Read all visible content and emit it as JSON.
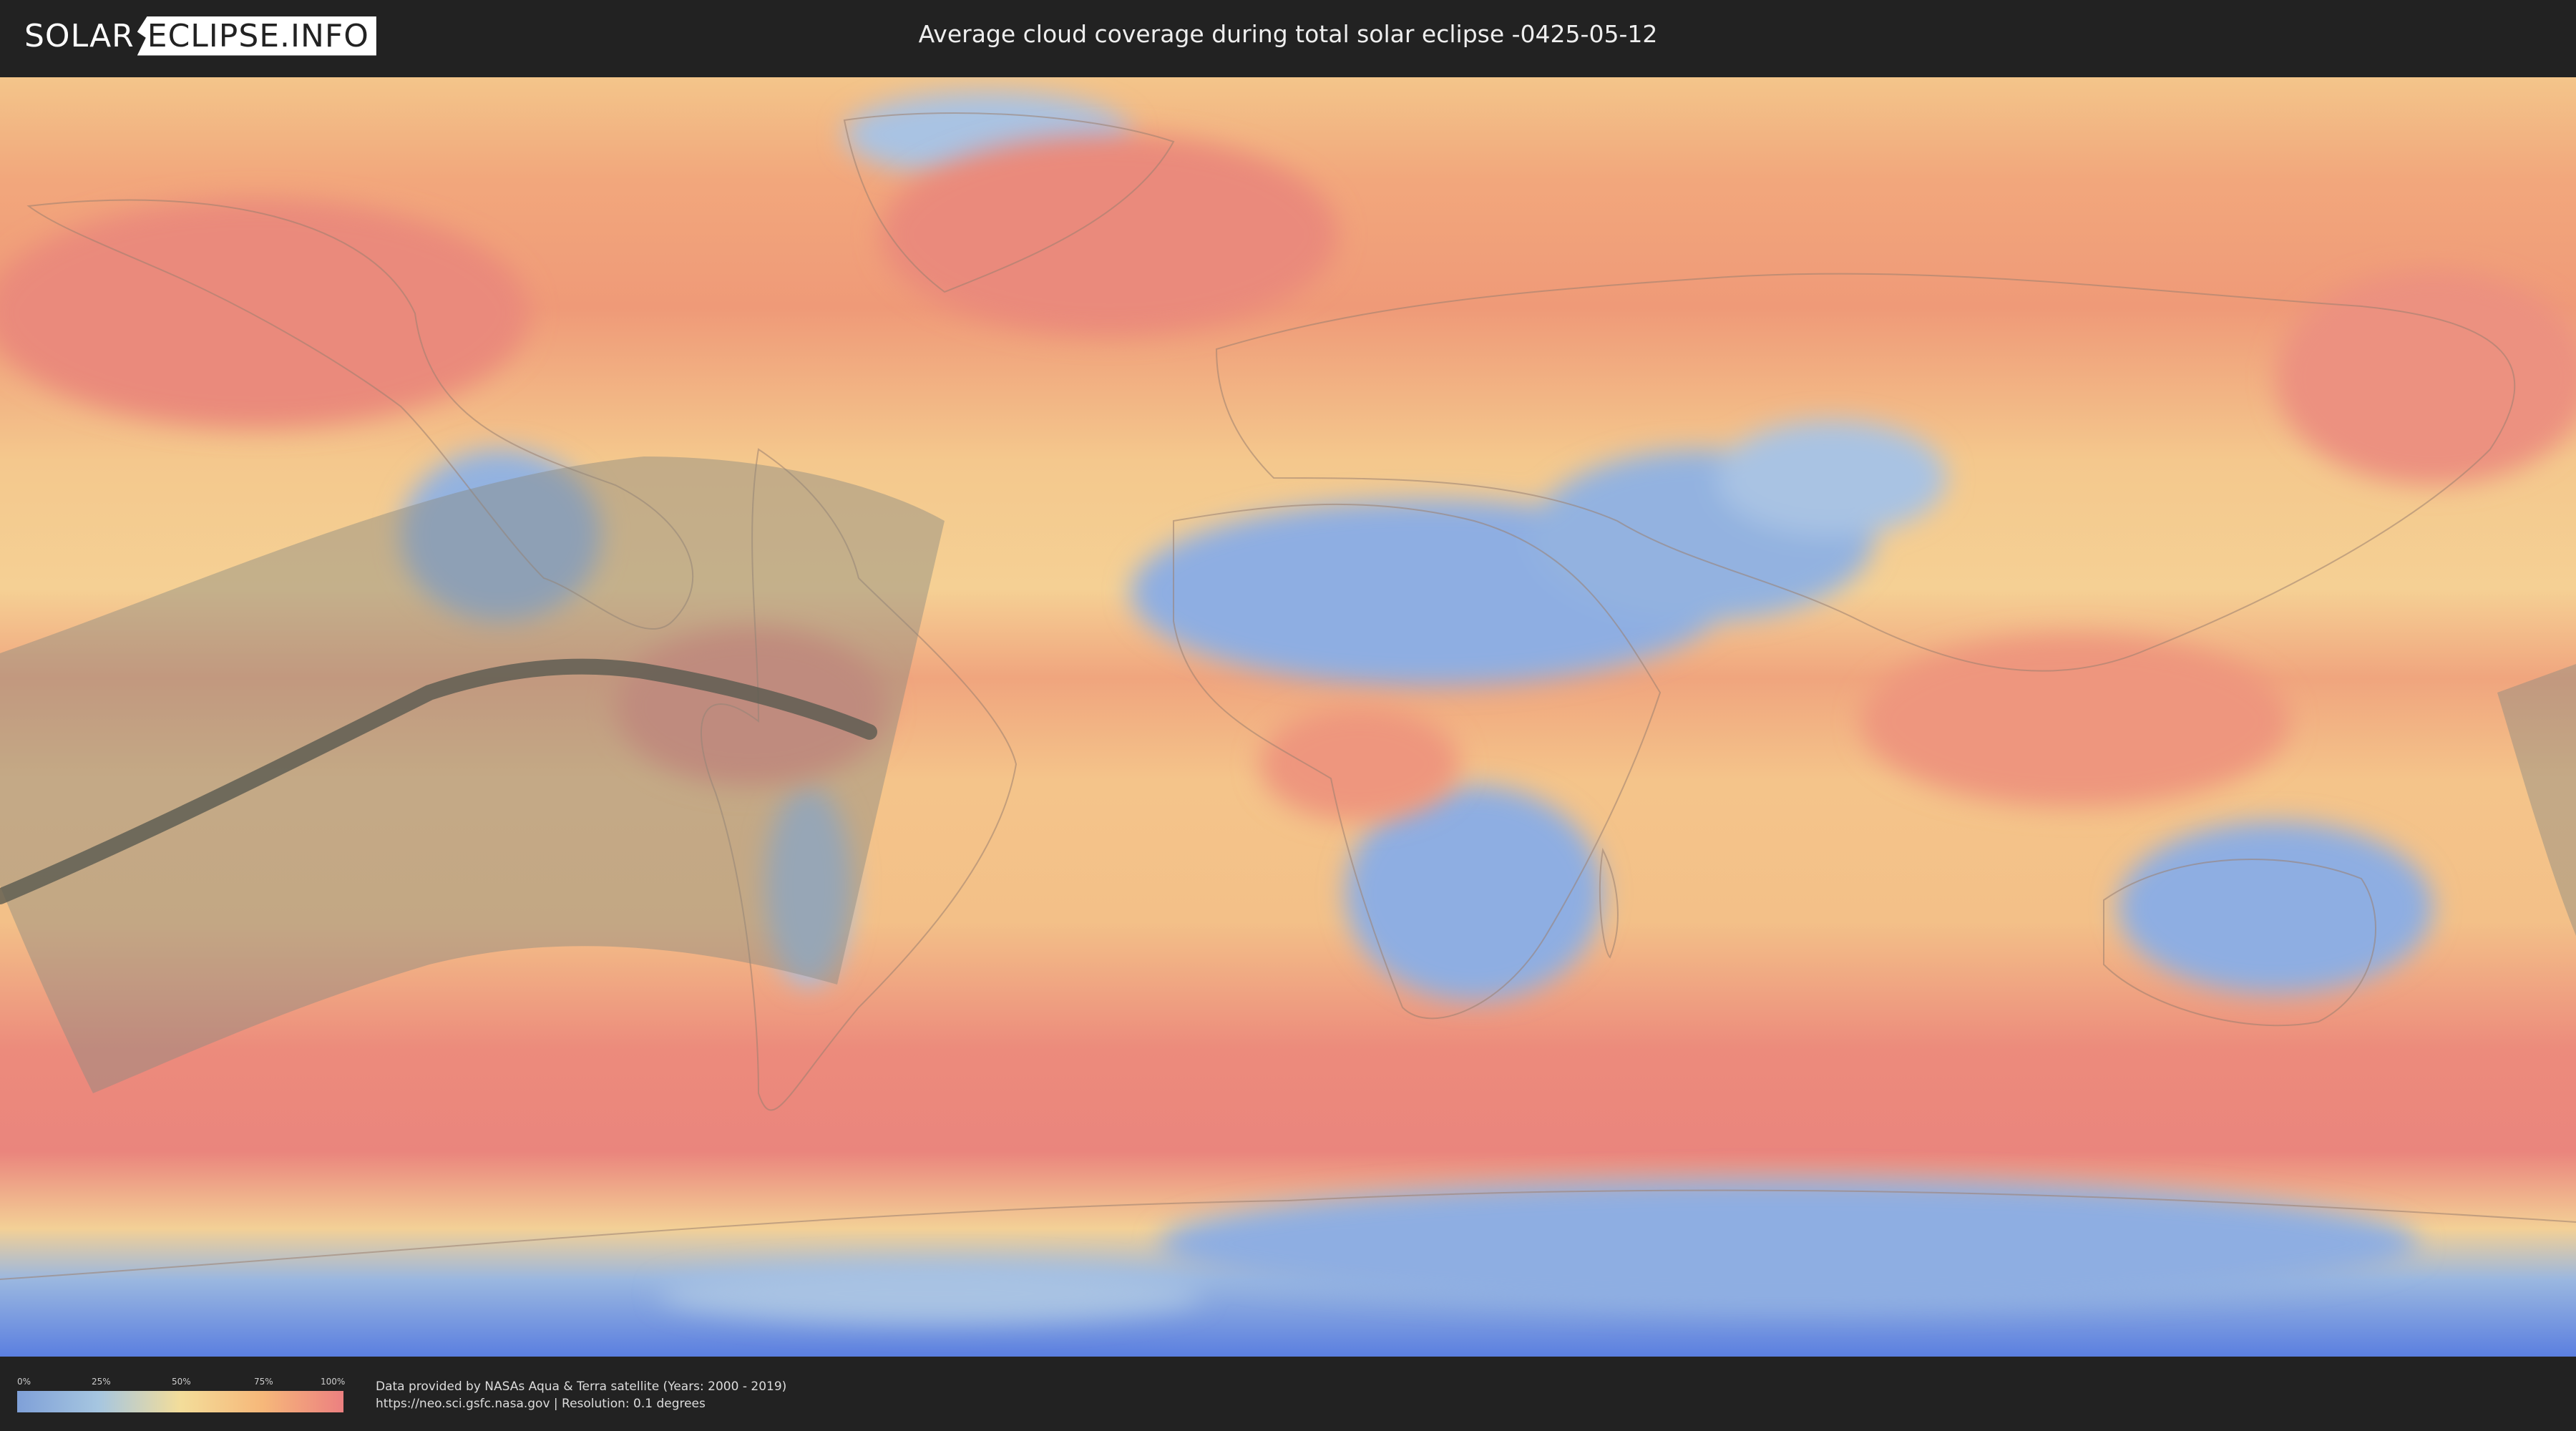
{
  "header": {
    "logo_part1": "SOLAR",
    "logo_part2": "ECLIPSE.INFO",
    "title": "Average cloud coverage during total solar eclipse -0425-05-12"
  },
  "legend": {
    "ticks": [
      "0%",
      "25%",
      "50%",
      "75%",
      "100%"
    ],
    "colors": [
      "#7fa0d8",
      "#a6c6e0",
      "#f3dd9a",
      "#f6b87a",
      "#ec8080"
    ]
  },
  "footer": {
    "credit_line1": "Data provided by NASAs Aqua & Terra satellite (Years: 2000 - 2019)",
    "credit_line2": "https://neo.sci.gsfc.nasa.gov | Resolution: 0.1 degrees"
  },
  "colors": {
    "background": "#222222",
    "eclipse_path": "#5a5a50",
    "partial_zone": "#8a8a80"
  }
}
